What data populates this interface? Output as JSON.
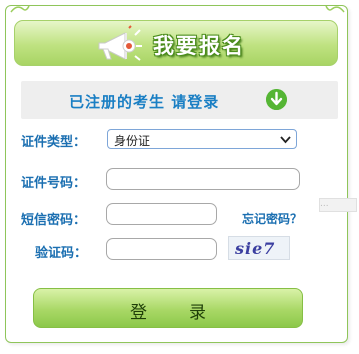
{
  "header": {
    "title": "我要报名"
  },
  "login_bar": {
    "text": "已注册的考生  请登录"
  },
  "form": {
    "id_type": {
      "label": "证件类型：",
      "value": "身份证"
    },
    "id_number": {
      "label": "证件号码：",
      "value": ""
    },
    "sms_password": {
      "label": "短信密码：",
      "value": ""
    },
    "forgot_password": "忘记密码？",
    "captcha": {
      "label": "验证码：",
      "value": "",
      "image_text": "sie7"
    },
    "ghost_placeholder": "..."
  },
  "submit_label": "登录",
  "colors": {
    "accent_green": "#a8d464",
    "label_blue": "#1b6fb1",
    "arrow_green": "#55b534"
  }
}
